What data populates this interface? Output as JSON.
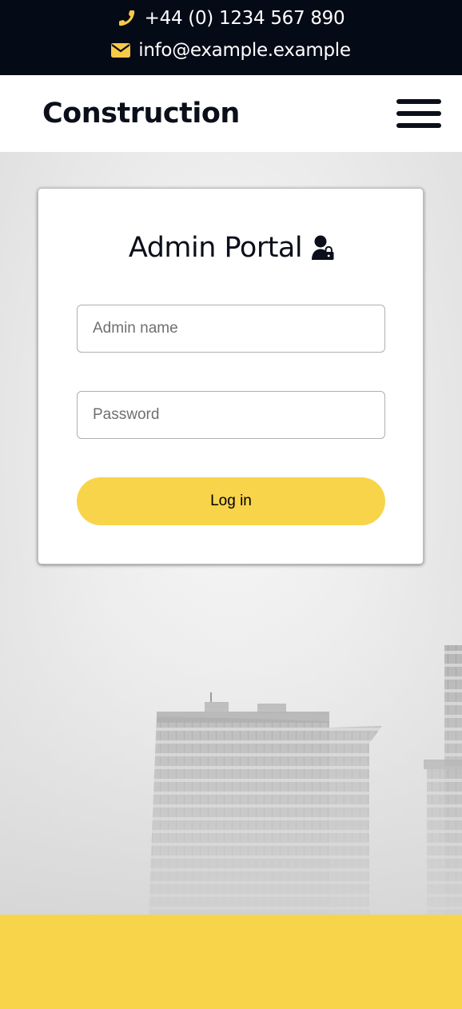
{
  "topbar": {
    "phone": "+44 (0) 1234 567 890",
    "email": "info@example.example",
    "icon_color": "#f7c948",
    "phone_icon": "phone-icon",
    "email_icon": "envelope-icon"
  },
  "navbar": {
    "brand": "Construction",
    "menu_icon": "hamburger-menu-icon"
  },
  "login": {
    "title": "Admin Portal",
    "title_icon": "user-lock-icon",
    "name_placeholder": "Admin name",
    "password_placeholder": "Password",
    "button_label": "Log in"
  },
  "colors": {
    "topbar_bg": "#050a17",
    "accent": "#f7d44a",
    "text": "#0b0f19"
  }
}
